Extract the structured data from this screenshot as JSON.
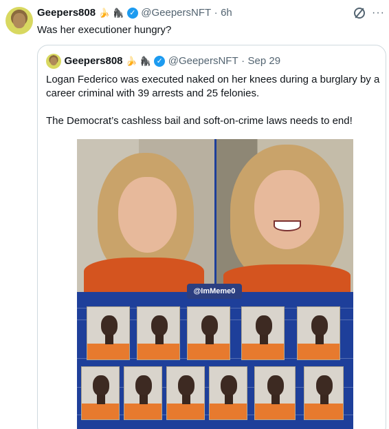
{
  "outer_tweet": {
    "author_name": "Geepers808",
    "emoji_1": "🍌",
    "emoji_2": "🦍",
    "verified_mark": "✓",
    "handle": "@GeepersNFT",
    "separator": "·",
    "time": "6h",
    "text": "Was her executioner hungry?",
    "icons": [
      "grok-slash-icon",
      "more-icon"
    ],
    "more_glyph": "···"
  },
  "quoted_tweet": {
    "author_name": "Geepers808",
    "emoji_1": "🍌",
    "emoji_2": "🦍",
    "verified_mark": "✓",
    "handle": "@GeepersNFT",
    "separator": "·",
    "time": "Sep 29",
    "paragraph_1": "Logan Federico was executed naked on her knees during a burglary by a career criminal with 39 arrests and 25 felonies.",
    "paragraph_2": "The Democrat’s cashless bail and soft-on-crime laws needs to end!",
    "media": {
      "watermark": "@ImMeme0",
      "mugshot_count": 11
    }
  },
  "colors": {
    "verified_blue": "#1d9bf0",
    "secondary_text": "#536471",
    "border": "#cfd9de",
    "media_bg": "#1e3f9a"
  }
}
